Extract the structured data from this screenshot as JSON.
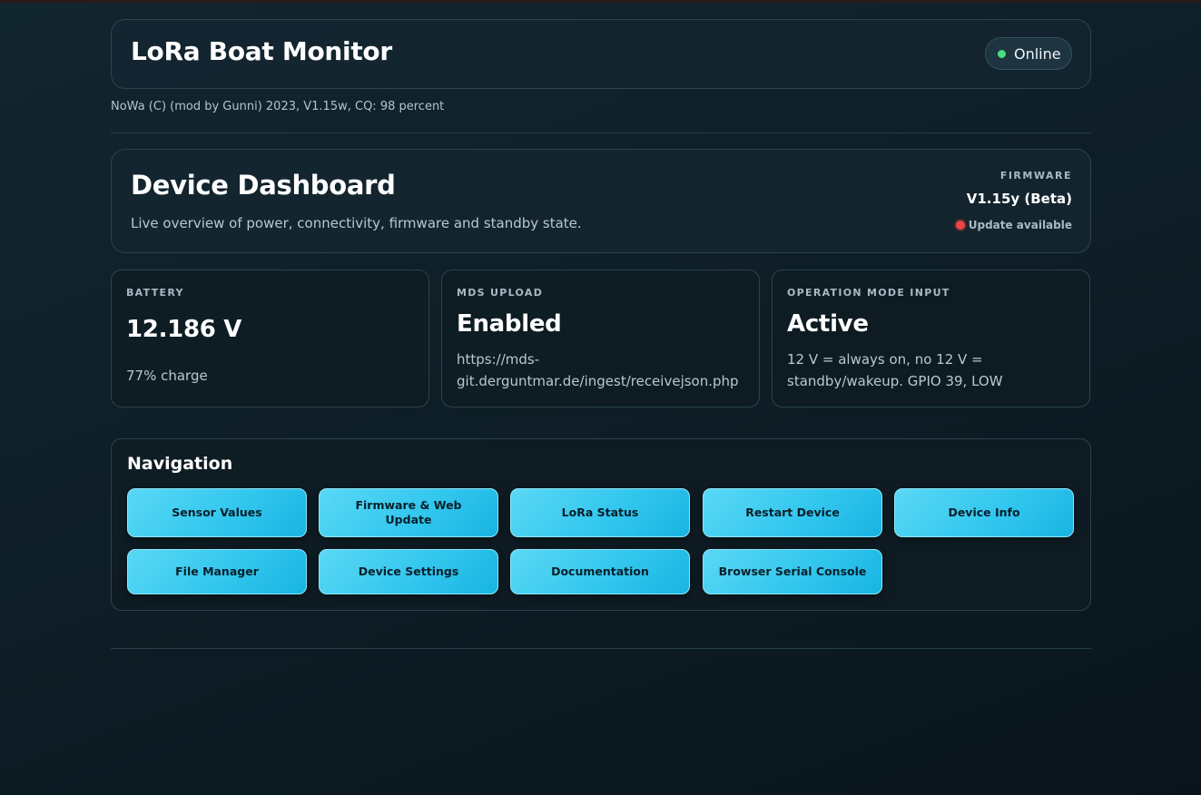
{
  "header": {
    "title": "LoRa Boat Monitor",
    "status": "Online",
    "status_color": "#4ade80"
  },
  "credits": "NoWa (C) (mod by Gunni) 2023, V1.15w, CQ: 98 percent",
  "dashboard": {
    "title": "Device Dashboard",
    "subtitle": "Live overview of power, connectivity, firmware and standby state.",
    "firmware_label": "FIRMWARE",
    "firmware_version": "V1.15y (Beta)",
    "update_text": "Update available",
    "update_color": "#ef4444"
  },
  "cards": [
    {
      "label": "BATTERY",
      "value": "12.186 V",
      "desc": "77% charge"
    },
    {
      "label": "MDS UPLOAD",
      "value": "Enabled",
      "desc": "https://mds-git.derguntmar.de/ingest/receivejson.php"
    },
    {
      "label": "OPERATION MODE INPUT",
      "value": "Active",
      "desc": "12 V = always on, no 12 V = standby/wakeup. GPIO 39, LOW"
    }
  ],
  "navigation": {
    "title": "Navigation",
    "buttons": [
      "Sensor Values",
      "Firmware & Web Update",
      "LoRa Status",
      "Restart Device",
      "Device Info",
      "File Manager",
      "Device Settings",
      "Documentation",
      "Browser Serial Console"
    ]
  },
  "colors": {
    "accent": "#33c7ee",
    "background": "#0f1f28"
  }
}
